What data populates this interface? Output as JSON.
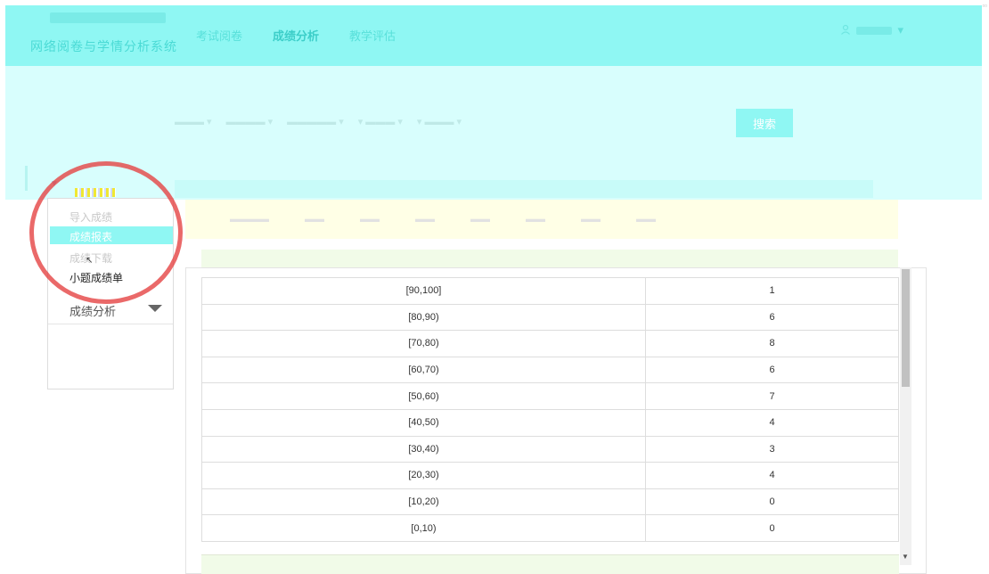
{
  "header": {
    "system_title": "网络阅卷与学情分析系统",
    "nav": [
      "考试阅卷",
      "成绩分析",
      "教学评估"
    ],
    "active_nav": "成绩分析",
    "user_icon": "user-icon"
  },
  "filters": {
    "search_label": "搜索"
  },
  "sidebar": {
    "items": [
      {
        "label": "导入成绩"
      },
      {
        "label": "成绩报表"
      },
      {
        "label": "成绩下载"
      },
      {
        "label": "小题成绩单"
      }
    ],
    "section_label": "成绩分析",
    "chevron_icon": "chevron-down-icon"
  },
  "table": {
    "rows": [
      {
        "range": "[90,100]",
        "count": "1"
      },
      {
        "range": "[80,90)",
        "count": "6"
      },
      {
        "range": "[70,80)",
        "count": "8"
      },
      {
        "range": "[60,70)",
        "count": "6"
      },
      {
        "range": "[50,60)",
        "count": "7"
      },
      {
        "range": "[40,50)",
        "count": "4"
      },
      {
        "range": "[30,40)",
        "count": "3"
      },
      {
        "range": "[20,30)",
        "count": "4"
      },
      {
        "range": "[10,20)",
        "count": "0"
      },
      {
        "range": "[0,10)",
        "count": "0"
      }
    ]
  },
  "colors": {
    "accent": "#8ff7f3",
    "highlight_circle": "#e54343"
  }
}
